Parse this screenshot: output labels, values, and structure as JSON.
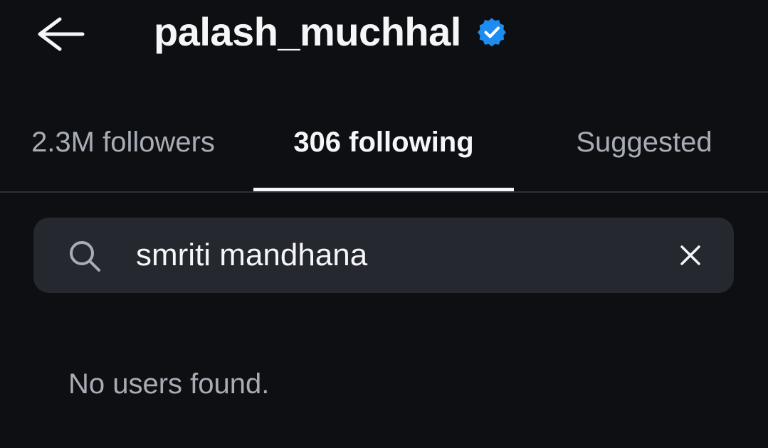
{
  "header": {
    "back_icon": "arrow-left-icon",
    "title": "palash_muchhal",
    "verified_icon": "verified-badge-icon",
    "verified_color": "#1d8cf0"
  },
  "tabs": [
    {
      "label": "2.3M followers",
      "active": false
    },
    {
      "label": "306 following",
      "active": true
    },
    {
      "label": "Suggested",
      "active": false
    }
  ],
  "search": {
    "icon": "search-icon",
    "value": "smriti mandhana",
    "clear_icon": "close-icon"
  },
  "results": {
    "empty_message": "No users found."
  },
  "colors": {
    "background": "#0d0f13",
    "search_bg": "#25282e",
    "text_primary": "#f5f6f8",
    "text_secondary": "#a8adb5"
  }
}
